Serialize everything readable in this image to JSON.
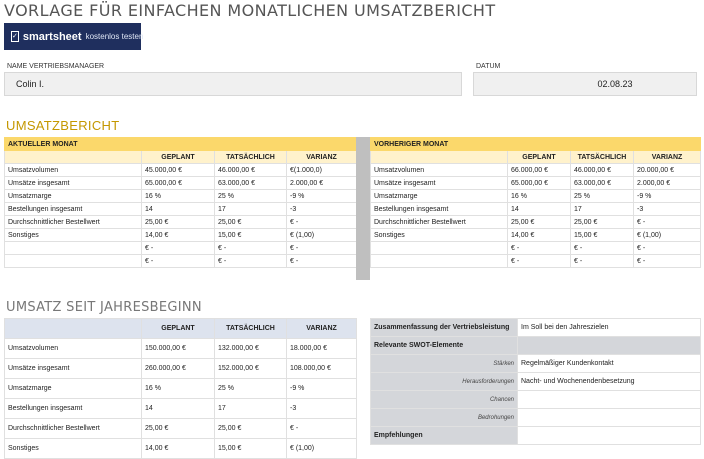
{
  "title": "VORLAGE FÜR EINFACHEN MONATLICHEN UMSATZBERICHT",
  "logo": {
    "icon": "check-icon",
    "brand": "smartsheet",
    "cta": "kostenlos testen"
  },
  "manager": {
    "label": "NAME VERTRIEBSMANAGER",
    "value": "Colin I."
  },
  "date": {
    "label": "DATUM",
    "value": "02.08.23"
  },
  "report": {
    "title": "UMSATZBERICHT",
    "current": {
      "header": "AKTUELLER MONAT",
      "columns": [
        "",
        "GEPLANT",
        "TATSÄCHLICH",
        "VARIANZ"
      ],
      "rows": [
        [
          "Umsatzvolumen",
          "45.000,00 €",
          "46.000,00 €",
          "€(1.000,0)"
        ],
        [
          "Umsätze insgesamt",
          "65.000,00 €",
          "63.000,00 €",
          "2.000,00 €"
        ],
        [
          "Umsatzmarge",
          "16 %",
          "25 %",
          "-9 %"
        ],
        [
          "Bestellungen insgesamt",
          "14",
          "17",
          "-3"
        ],
        [
          "Durchschnittlicher Bestellwert",
          "25,00 €",
          "25,00 €",
          "€ -"
        ],
        [
          "Sonstiges",
          "14,00 €",
          "15,00 €",
          "€ (1,00)"
        ],
        [
          "",
          "€ -",
          "€ -",
          "€ -"
        ],
        [
          "",
          "€ -",
          "€ -",
          "€ -"
        ]
      ]
    },
    "previous": {
      "header": "VORHERIGER MONAT",
      "columns": [
        "",
        "GEPLANT",
        "TATSÄCHLICH",
        "VARIANZ"
      ],
      "rows": [
        [
          "Umsatzvolumen",
          "66.000,00 €",
          "46.000,00 €",
          "20.000,00 €"
        ],
        [
          "Umsätze insgesamt",
          "65.000,00 €",
          "63.000,00 €",
          "2.000,00 €"
        ],
        [
          "Umsatzmarge",
          "16 %",
          "25 %",
          "-9 %"
        ],
        [
          "Bestellungen insgesamt",
          "14",
          "17",
          "-3"
        ],
        [
          "Durchschnittlicher Bestellwert",
          "25,00 €",
          "25,00 €",
          "€ -"
        ],
        [
          "Sonstiges",
          "14,00 €",
          "15,00 €",
          "€ (1,00)"
        ],
        [
          "",
          "€ -",
          "€ -",
          "€ -"
        ],
        [
          "",
          "€ -",
          "€ -",
          "€ -"
        ]
      ]
    }
  },
  "ytd": {
    "title": "UMSATZ SEIT JAHRESBEGINN",
    "columns": [
      "",
      "GEPLANT",
      "TATSÄCHLICH",
      "VARIANZ"
    ],
    "rows": [
      [
        "Umsatzvolumen",
        "150.000,00 €",
        "132.000,00 €",
        "18.000,00 €"
      ],
      [
        "Umsätze insgesamt",
        "260.000,00 €",
        "152.000,00 €",
        "108.000,00 €"
      ],
      [
        "Umsatzmarge",
        "16 %",
        "25 %",
        "-9 %"
      ],
      [
        "Bestellungen insgesamt",
        "14",
        "17",
        "-3"
      ],
      [
        "Durchschnittlicher Bestellwert",
        "25,00 €",
        "25,00 €",
        "€ -"
      ],
      [
        "Sonstiges",
        "14,00 €",
        "15,00 €",
        "€ (1,00)"
      ]
    ]
  },
  "summary": {
    "perf_label": "Zusammenfassung der Vertriebsleistung",
    "perf_value": "Im Soll bei den Jahreszielen",
    "swot_label": "Relevante SWOT-Elemente",
    "swot": [
      [
        "Stärken",
        "Regelmäßiger Kundenkontakt"
      ],
      [
        "Herausforderungen",
        "Nacht- und Wochenendenbesetzung"
      ],
      [
        "Chancen",
        ""
      ],
      [
        "Bedrohungen",
        ""
      ]
    ],
    "recommend_label": "Empfehlungen"
  }
}
